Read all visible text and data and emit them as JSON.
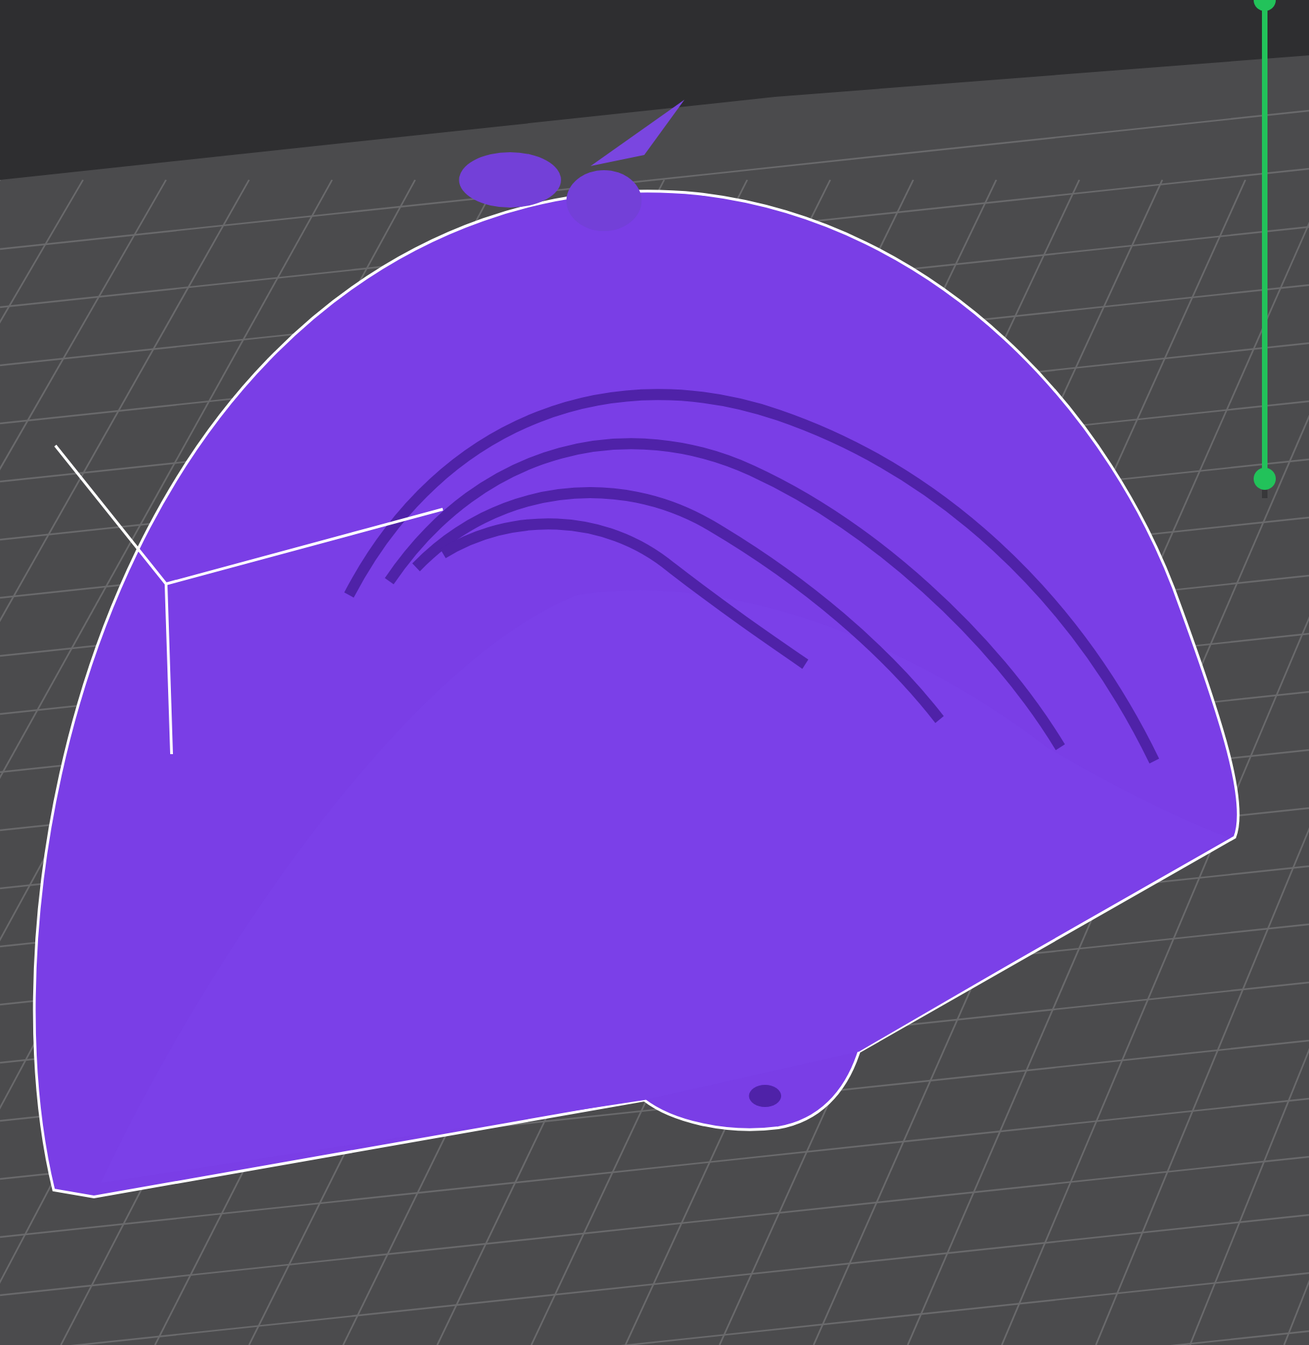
{
  "viewport": {
    "layer_slider": {
      "level": 0.96
    }
  }
}
